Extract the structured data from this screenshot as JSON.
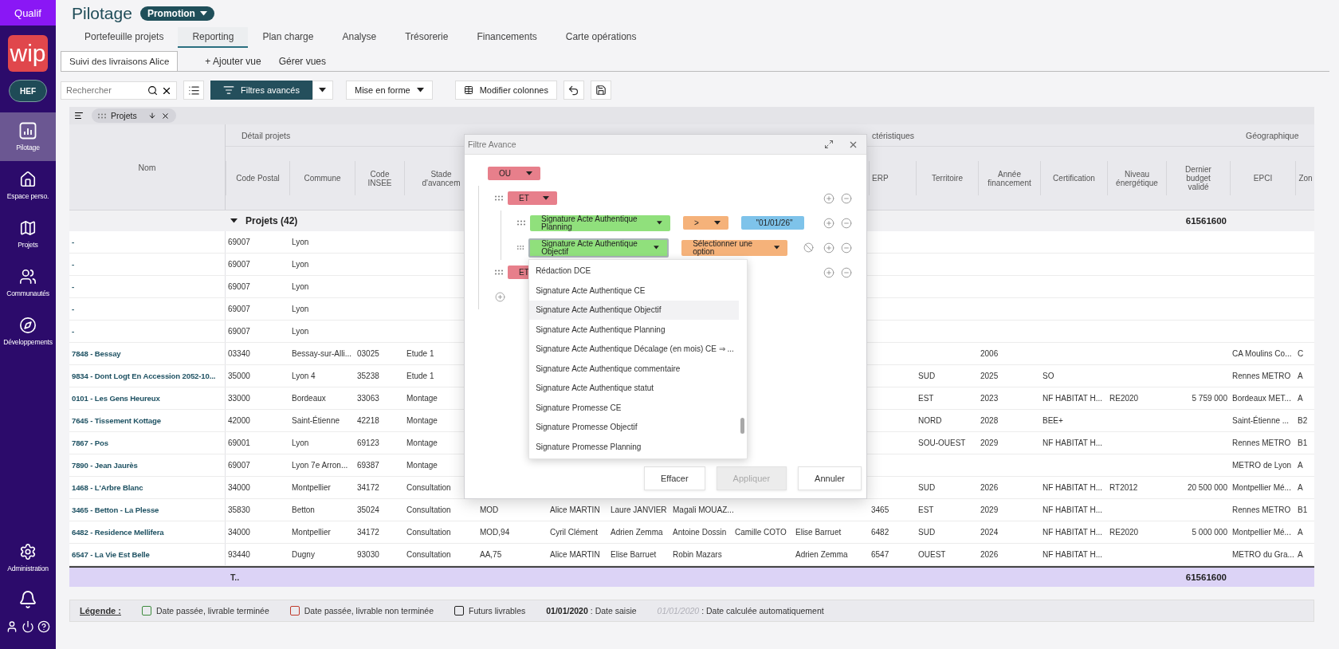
{
  "sidebar": {
    "environment": "Qualif",
    "logo": "wip",
    "user_badge": "HEF",
    "items": [
      {
        "label": "Pilotage",
        "selected": true
      },
      {
        "label": "Espace perso.",
        "selected": false
      },
      {
        "label": "Projets",
        "selected": false
      },
      {
        "label": "Communautés",
        "selected": false
      },
      {
        "label": "Développements",
        "selected": false
      }
    ],
    "admin": {
      "label": "Administration"
    }
  },
  "header": {
    "title": "Pilotage",
    "badge": "Promotion"
  },
  "nav_tabs": [
    {
      "label": "Portefeuille projets",
      "selected": false
    },
    {
      "label": "Reporting",
      "selected": true
    },
    {
      "label": "Plan charge",
      "selected": false
    },
    {
      "label": "Analyse",
      "selected": false
    },
    {
      "label": "Trésorerie",
      "selected": false
    },
    {
      "label": "Financements",
      "selected": false
    },
    {
      "label": "Carte opérations",
      "selected": false
    }
  ],
  "views": {
    "tabs": [
      {
        "label": "Suivi des livraisons Alice",
        "selected": true
      }
    ],
    "actions": [
      "+ Ajouter vue",
      "Gérer vues"
    ]
  },
  "toolbar": {
    "search": {
      "placeholder": "Rechercher"
    },
    "filter_button": "Filtres avancés",
    "format_button": "Mise en forme",
    "columns_button": "Modifier colonnes"
  },
  "grouping": {
    "chips": [
      {
        "label": "Projets"
      }
    ]
  },
  "table": {
    "columns": [
      {
        "label": "Nom",
        "kind": "name"
      },
      {
        "label": "Code Postal",
        "kind": "text",
        "group": "Détail projets"
      },
      {
        "label": "Commune",
        "kind": "text"
      },
      {
        "label": "Code INSEE",
        "kind": "text"
      },
      {
        "label": "Stade d'avancem",
        "kind": "text"
      },
      {
        "kind": "text"
      },
      {
        "kind": "text"
      },
      {
        "kind": "text"
      },
      {
        "kind": "text"
      },
      {
        "kind": "text"
      },
      {
        "kind": "text"
      },
      {
        "label": "ERP",
        "kind": "text",
        "group": "ctéristiques"
      },
      {
        "label": "Territoire",
        "kind": "text"
      },
      {
        "label": "Année financement",
        "kind": "text"
      },
      {
        "label": "Certification",
        "kind": "text"
      },
      {
        "label": "Niveau énergétique",
        "kind": "text"
      },
      {
        "label": "Dernier budget validé",
        "kind": "number"
      },
      {
        "label": "EPCI",
        "kind": "text",
        "group": "Géographique"
      },
      {
        "label": "Zon",
        "kind": "text"
      }
    ],
    "group_row": {
      "label": "Projets (42)",
      "expanded": true,
      "total": "61561600"
    },
    "rows": [
      {
        "cells": [
          "-",
          "69007",
          "Lyon"
        ]
      },
      {
        "cells": [
          "-",
          "69007",
          "Lyon"
        ]
      },
      {
        "cells": [
          "-",
          "69007",
          "Lyon"
        ]
      },
      {
        "cells": [
          "-",
          "69007",
          "Lyon"
        ]
      },
      {
        "cells": [
          "-",
          "69007",
          "Lyon"
        ]
      },
      {
        "cells": [
          "7848 - Bessay",
          "03340",
          "Bessay-sur-Alli...",
          "03025",
          "Etude 1",
          null,
          null,
          null,
          null,
          null,
          null,
          null,
          null,
          "2006",
          null,
          null,
          null,
          "CA Moulins Co...",
          "C"
        ]
      },
      {
        "cells": [
          "9834 - Dont Logt En Accession 2052-10...",
          "35000",
          "Lyon 4",
          "35238",
          "Etude 1",
          null,
          null,
          null,
          null,
          null,
          null,
          null,
          "SUD",
          "2025",
          "SO",
          null,
          null,
          "Rennes METRO",
          "A"
        ]
      },
      {
        "cells": [
          "0101 - Les Gens Heureux",
          "33000",
          "Bordeaux",
          "33063",
          "Montage",
          null,
          null,
          null,
          null,
          null,
          null,
          null,
          "EST",
          "2023",
          "NF HABITAT H...",
          "RE2020",
          "5 759 000",
          "Bordeaux MET...",
          "A"
        ]
      },
      {
        "cells": [
          "7645 - Tissement Kottage",
          "42000",
          "Saint-Étienne",
          "42218",
          "Montage",
          null,
          null,
          null,
          null,
          null,
          null,
          null,
          "NORD",
          "2028",
          "BEE+",
          null,
          null,
          "Saint-Étienne ...",
          "B2"
        ]
      },
      {
        "cells": [
          "7867 - Pos",
          "69001",
          "Lyon",
          "69123",
          "Montage",
          null,
          null,
          null,
          null,
          null,
          null,
          null,
          "SOU-OUEST",
          "2029",
          "NF HABITAT H...",
          null,
          null,
          "Rennes METRO",
          "B1"
        ]
      },
      {
        "cells": [
          "7890 - Jean Jaurès",
          "69007",
          "Lyon 7e Arron...",
          "69387",
          "Montage",
          null,
          null,
          null,
          null,
          null,
          null,
          null,
          null,
          null,
          null,
          null,
          null,
          "METRO de Lyon",
          "A"
        ]
      },
      {
        "cells": [
          "1468 - L'Arbre Blanc",
          "34000",
          "Montpellier",
          "34172",
          "Consultation",
          null,
          null,
          null,
          null,
          null,
          null,
          null,
          "SUD",
          "2026",
          "NF HABITAT H...",
          "RT2012",
          "20 500 000",
          "Montpellier Mé...",
          "A"
        ]
      },
      {
        "cells": [
          "3465 - Betton - La Plesse",
          "35830",
          "Betton",
          "35024",
          "Consultation",
          "MOD",
          "Alice MARTIN",
          "Laure JANVIER",
          "Magali MOUAZ...",
          null,
          null,
          "3465",
          "EST",
          "2029",
          "NF HABITAT H...",
          null,
          null,
          "Rennes METRO",
          "B1"
        ]
      },
      {
        "cells": [
          "6482 - Residence Mellifera",
          "34000",
          "Montpellier",
          "34172",
          "Consultation",
          "MOD,94",
          "Cyril Clément",
          "Adrien Zemma",
          "Antoine Dossin",
          "Camille COTO",
          "Elise Barruet",
          "6482",
          "SUD",
          "2024",
          "NF HABITAT H...",
          "RE2020",
          "5 000 000",
          "Montpellier Mé...",
          "A"
        ]
      },
      {
        "cells": [
          "6547 - La Vie Est Belle",
          "93440",
          "Dugny",
          "93030",
          "Consultation",
          "AA,75",
          "Alice MARTIN",
          "Elise Barruet",
          "Robin Mazars",
          null,
          "Adrien Zemma",
          "6547",
          "OUEST",
          "2026",
          "NF HABITAT H...",
          null,
          null,
          "METRO du Gra...",
          "A"
        ]
      }
    ],
    "total_row": {
      "label": "T..",
      "total": "61561600"
    }
  },
  "legend": {
    "title": "Légende :",
    "items": [
      {
        "kind": "checkbox",
        "color": "#3d8b3d",
        "label": "Date passée, livrable terminée"
      },
      {
        "kind": "checkbox",
        "color": "#c0392b",
        "label": "Date passée, livrable non terminée"
      },
      {
        "kind": "checkbox",
        "color": "#222222",
        "label": "Futurs livrables"
      },
      {
        "kind": "entered",
        "sample": "01/01/2020",
        "label": ": Date saisie"
      },
      {
        "kind": "computed",
        "sample": "01/01/2020",
        "label": ": Date calculée automatiquement"
      }
    ]
  },
  "filter_dialog": {
    "title": "Filtre Avance",
    "tree": {
      "kind": "group",
      "operator": "OU",
      "children": [
        {
          "kind": "group",
          "operator": "ET",
          "children": [
            {
              "kind": "rule",
              "field": "Signature Acte Authentique Planning",
              "operator": ">",
              "value": "\"01/01/26\""
            },
            {
              "kind": "rule",
              "field": "Signature Acte Authentique Objectif",
              "placeholder": "Sélectionner une option",
              "open": true,
              "options": [
                {
                  "label": "Rédaction DCE",
                  "selected": false
                },
                {
                  "label": "Signature Acte Authentique CE",
                  "selected": false
                },
                {
                  "label": "Signature Acte Authentique Objectif",
                  "selected": true
                },
                {
                  "label": "Signature Acte Authentique Planning",
                  "selected": false
                },
                {
                  "label": "Signature Acte Authentique Décalage (en mois) CE ⇒ ...",
                  "selected": false
                },
                {
                  "label": "Signature Acte Authentique commentaire",
                  "selected": false
                },
                {
                  "label": "Signature Acte Authentique statut",
                  "selected": false
                },
                {
                  "label": "Signature Promesse CE",
                  "selected": false
                },
                {
                  "label": "Signature Promesse Objectif",
                  "selected": false
                },
                {
                  "label": "Signature Promesse Planning",
                  "selected": false
                }
              ]
            }
          ]
        },
        {
          "kind": "group",
          "operator": "ET"
        }
      ]
    },
    "buttons": [
      {
        "label": "Effacer",
        "disabled": false
      },
      {
        "label": "Appliquer",
        "disabled": true
      },
      {
        "label": "Annuler",
        "disabled": false
      }
    ]
  }
}
